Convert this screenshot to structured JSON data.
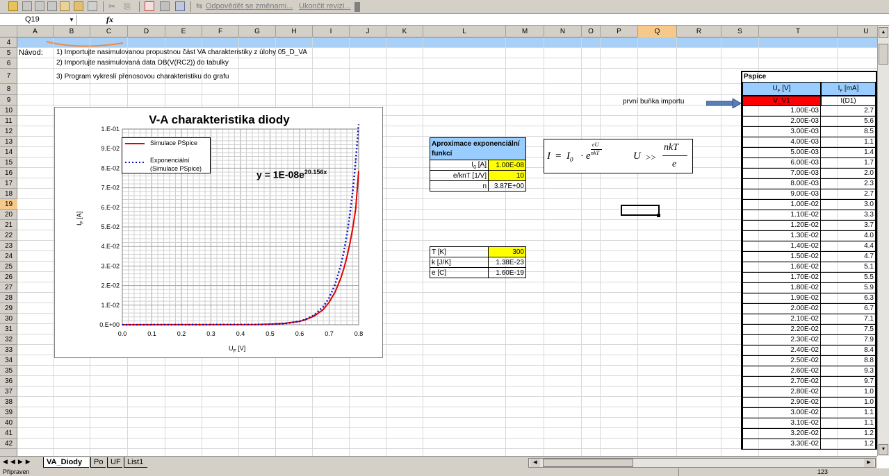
{
  "toolbar": {
    "reply_label": "Odpovědět se změnami...",
    "end_review_label": "Ukončit revizi..."
  },
  "formula_bar": {
    "name_box": "Q19",
    "fx": "fx",
    "formula": ""
  },
  "columns": [
    "A",
    "B",
    "C",
    "D",
    "E",
    "F",
    "G",
    "H",
    "I",
    "J",
    "K",
    "L",
    "M",
    "N",
    "O",
    "P",
    "Q",
    "R",
    "S",
    "T",
    "U"
  ],
  "selected_column": "Q",
  "rows": [
    "4",
    "5",
    "6",
    "7",
    "8",
    "9",
    "10",
    "11",
    "12",
    "13",
    "14",
    "15",
    "16",
    "17",
    "18",
    "19",
    "20",
    "21",
    "22",
    "23",
    "24",
    "25",
    "26",
    "27",
    "28",
    "29",
    "30",
    "31",
    "32",
    "33",
    "34",
    "35",
    "36",
    "37",
    "38",
    "39",
    "40",
    "41",
    "42"
  ],
  "selected_row": "19",
  "instructions": {
    "label": "Návod:",
    "line1": "1) Importujte nasimulovanou propustnou část VA charakteristiky z úlohy 05_D_VA",
    "line2": "2) Importujte nasimulovaná data DB(V(RC2)) do tabulky",
    "line3": "3) Program vykreslí přenosovou charakteristiku do grafu"
  },
  "import_note": "první buňka importu",
  "chart_data": {
    "type": "line",
    "title": "V-A charakteristika diody",
    "xlabel": "U",
    "xlabel_sub": "F",
    "xlabel_unit": " [V]",
    "ylabel": "I",
    "ylabel_sub": "F",
    "ylabel_unit": " [A]",
    "xlim": [
      0.0,
      0.8
    ],
    "ylim": [
      0.0,
      0.1
    ],
    "x_ticks": [
      "0.0",
      "0.1",
      "0.2",
      "0.3",
      "0.4",
      "0.5",
      "0.6",
      "0.7",
      "0.8"
    ],
    "y_ticks": [
      "0.E+00",
      "1.E-02",
      "2.E-02",
      "3.E-02",
      "4.E-02",
      "5.E-02",
      "6.E-02",
      "7.E-02",
      "8.E-02",
      "9.E-02",
      "1.E-01"
    ],
    "grid": true,
    "legend_position": "top-left",
    "equation_label": "y = 1E-08e",
    "equation_exp": "20.156x",
    "series": [
      {
        "name": "Simulace PSpice",
        "color": "#e00000",
        "style": "solid",
        "x": [
          0.0,
          0.45,
          0.5,
          0.55,
          0.6,
          0.62,
          0.65,
          0.68,
          0.7,
          0.72,
          0.74,
          0.75,
          0.76,
          0.77,
          0.78,
          0.79,
          0.8
        ],
        "y": [
          0.0,
          0.0001,
          0.0003,
          0.0007,
          0.0017,
          0.0026,
          0.0045,
          0.0077,
          0.0115,
          0.0166,
          0.024,
          0.0288,
          0.0345,
          0.0413,
          0.0494,
          0.0592,
          0.0785
        ]
      },
      {
        "name": "Exponenciální (Simulace PSpice)",
        "color": "#1010c0",
        "style": "dotted",
        "x": [
          0.0,
          0.45,
          0.5,
          0.55,
          0.6,
          0.62,
          0.65,
          0.68,
          0.7,
          0.72,
          0.74,
          0.75,
          0.76,
          0.77,
          0.78,
          0.79,
          0.8
        ],
        "y": [
          0.0,
          0.0001,
          0.0002,
          0.0006,
          0.0018,
          0.0027,
          0.005,
          0.0092,
          0.0137,
          0.0205,
          0.0306,
          0.0374,
          0.0458,
          0.056,
          0.0684,
          0.0837,
          0.1023
        ]
      }
    ]
  },
  "approx_table": {
    "header": "Aproximace exponenciální funkcí",
    "rows": [
      {
        "label": "I0 [A]",
        "label_main": "I",
        "label_sub": "0",
        "label_tail": " [A]",
        "value": "1.00E-08",
        "highlight": true
      },
      {
        "label_main": "e/knT  [1/V]",
        "label_sub": "",
        "label_tail": "",
        "value": "10",
        "highlight": true
      },
      {
        "label_main": "n",
        "label_sub": "",
        "label_tail": "",
        "value": "3.87E+00",
        "highlight": false
      }
    ]
  },
  "formula_box": {
    "I": "I",
    "eq": "=",
    "I0": "I",
    "I0_sub": "0",
    "dot": "·",
    "e": "e",
    "exp_num": "eU",
    "exp_den": "nkT",
    "U": "U",
    "gg": ">>",
    "frac_num": "nkT",
    "frac_den": "e"
  },
  "constants_table": [
    {
      "label": "T [K]",
      "value": "300",
      "highlight": true
    },
    {
      "label": "k [J/K]",
      "value": "1.38E-23",
      "highlight": false
    },
    {
      "label": "e [C]",
      "value": "1.60E-19",
      "highlight": false
    }
  ],
  "pspice": {
    "title": "Pspice",
    "col1_header": "U",
    "col1_sub": "F",
    "col1_unit": "  [V]",
    "col2_header": "I",
    "col2_sub": "F",
    "col2_unit": " [mA]",
    "first_row": [
      "V_V1",
      "I(D1)"
    ],
    "first_row_color": "#ff0000",
    "data": [
      [
        "1.00E-03",
        "2.7"
      ],
      [
        "2.00E-03",
        "5.6"
      ],
      [
        "3.00E-03",
        "8.5"
      ],
      [
        "4.00E-03",
        "1.1"
      ],
      [
        "5.00E-03",
        "1.4"
      ],
      [
        "6.00E-03",
        "1.7"
      ],
      [
        "7.00E-03",
        "2.0"
      ],
      [
        "8.00E-03",
        "2.3"
      ],
      [
        "9.00E-03",
        "2.7"
      ],
      [
        "1.00E-02",
        "3.0"
      ],
      [
        "1.10E-02",
        "3.3"
      ],
      [
        "1.20E-02",
        "3.7"
      ],
      [
        "1.30E-02",
        "4.0"
      ],
      [
        "1.40E-02",
        "4.4"
      ],
      [
        "1.50E-02",
        "4.7"
      ],
      [
        "1.60E-02",
        "5.1"
      ],
      [
        "1.70E-02",
        "5.5"
      ],
      [
        "1.80E-02",
        "5.9"
      ],
      [
        "1.90E-02",
        "6.3"
      ],
      [
        "2.00E-02",
        "6.7"
      ],
      [
        "2.10E-02",
        "7.1"
      ],
      [
        "2.20E-02",
        "7.5"
      ],
      [
        "2.30E-02",
        "7.9"
      ],
      [
        "2.40E-02",
        "8.4"
      ],
      [
        "2.50E-02",
        "8.8"
      ],
      [
        "2.60E-02",
        "9.3"
      ],
      [
        "2.70E-02",
        "9.7"
      ],
      [
        "2.80E-02",
        "1.0"
      ],
      [
        "2.90E-02",
        "1.0"
      ],
      [
        "3.00E-02",
        "1.1"
      ],
      [
        "3.10E-02",
        "1.1"
      ],
      [
        "3.20E-02",
        "1.2"
      ],
      [
        "3.30E-02",
        "1.2"
      ]
    ]
  },
  "sheet_tabs": [
    "VA_Diody",
    "Po",
    "UF",
    "List1"
  ],
  "active_tab": "VA_Diody",
  "status": {
    "left": "Připraven",
    "right": "123"
  },
  "colors": {
    "highlight_yellow": "#ffff00",
    "header_blue": "#99ccff",
    "band_blue": "#a8cff5",
    "selected_header": "#f6c98a"
  }
}
